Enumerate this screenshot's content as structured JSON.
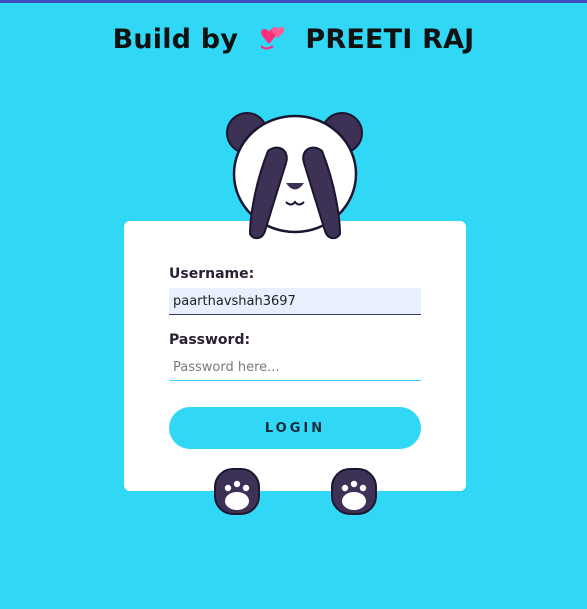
{
  "header": {
    "title_left": "Build by",
    "heart_icon": "two-hearts-icon",
    "title_right": "PREETI RAJ"
  },
  "login_form": {
    "username_label": "Username:",
    "username_value": "paarthavshah3697",
    "password_label": "Password:",
    "password_placeholder": "Password here...",
    "login_label": "LOGIN"
  },
  "colors": {
    "background": "#30d8f6",
    "card": "#ffffff",
    "panda_dark": "#3d3256",
    "accent": "#30d8f6"
  },
  "icons": {
    "panda": "panda-hiding-eyes-icon",
    "paw_left": "paw-icon",
    "paw_right": "paw-icon"
  }
}
